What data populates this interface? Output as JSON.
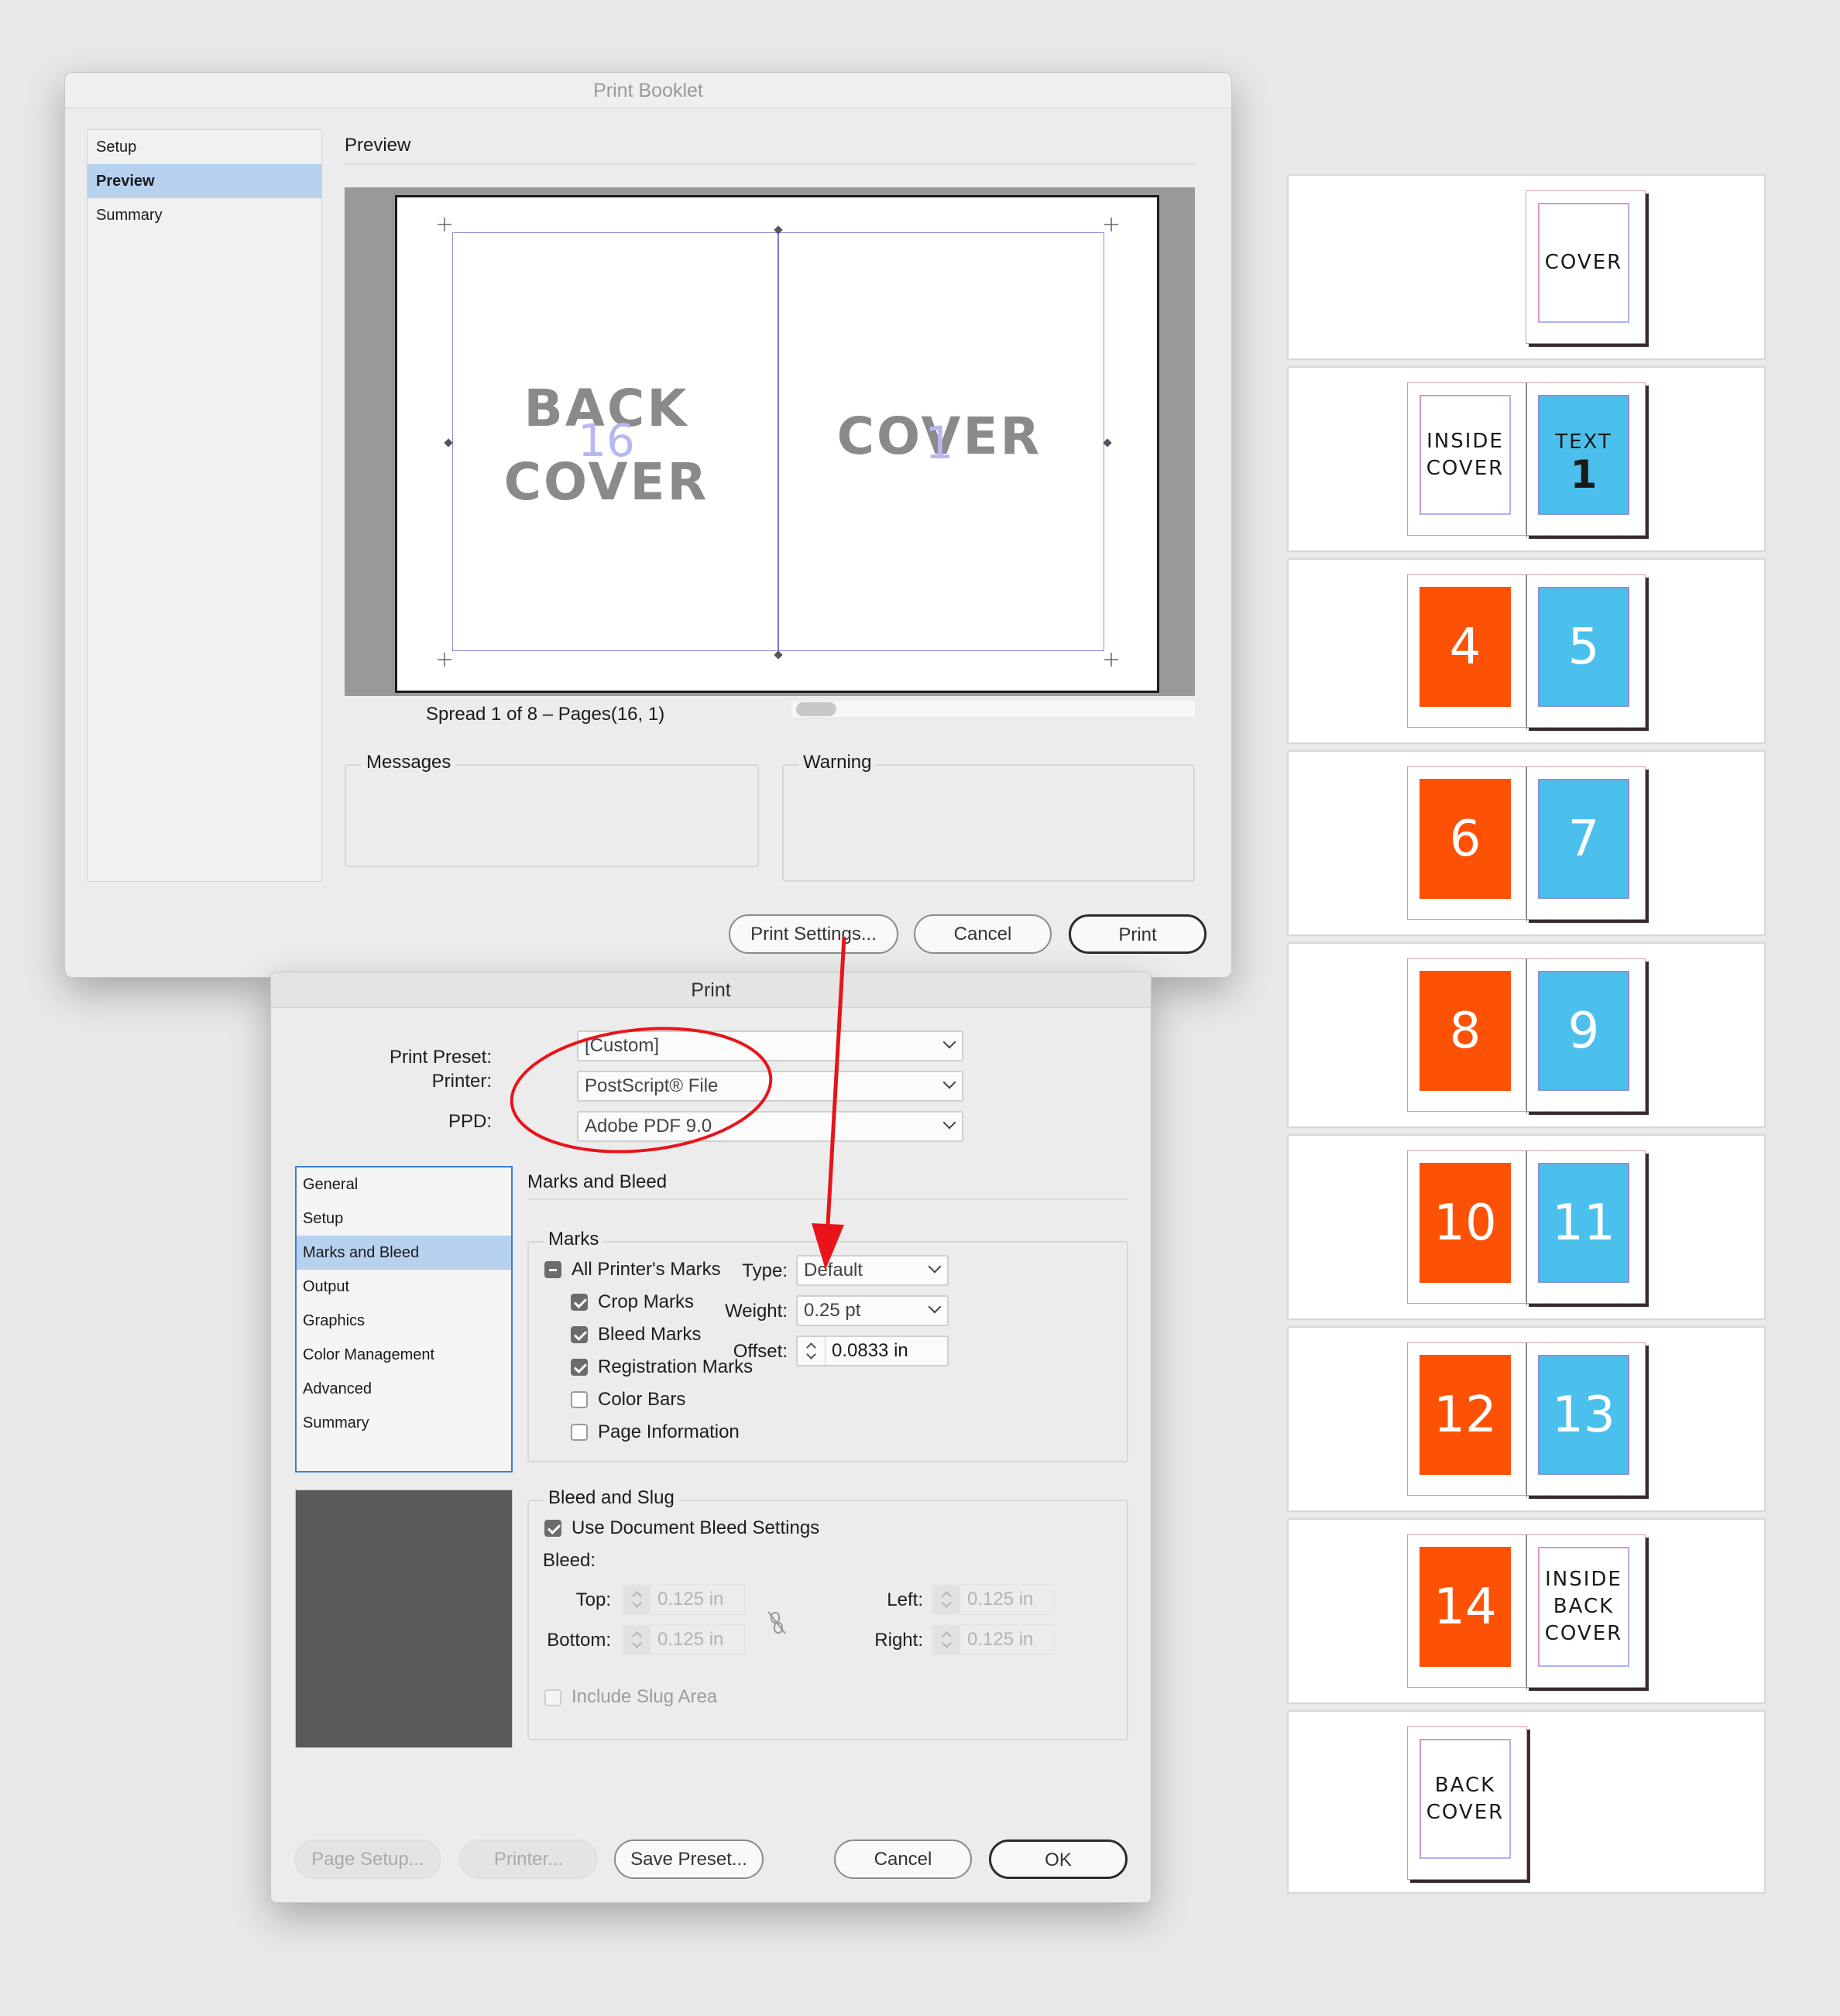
{
  "booklet": {
    "title": "Print Booklet",
    "sidebar": [
      {
        "label": "Setup",
        "selected": false
      },
      {
        "label": "Preview",
        "selected": true
      },
      {
        "label": "Summary",
        "selected": false
      }
    ],
    "section_title": "Preview",
    "spread_left_text": "BACK\nCOVER",
    "spread_left_num": "16",
    "spread_right_text": "COVER",
    "spread_right_num": "1",
    "spread_caption": "Spread 1 of 8 – Pages(16, 1)",
    "messages_label": "Messages",
    "warning_label": "Warning",
    "buttons": {
      "print_settings": "Print Settings...",
      "cancel": "Cancel",
      "print": "Print"
    }
  },
  "print": {
    "title": "Print",
    "preset_label": "Print Preset:",
    "preset_value": "[Custom]",
    "printer_label": "Printer:",
    "printer_value": "PostScript® File",
    "ppd_label": "PPD:",
    "ppd_value": "Adobe PDF 9.0",
    "categories": [
      {
        "label": "General",
        "selected": false
      },
      {
        "label": "Setup",
        "selected": false
      },
      {
        "label": "Marks and Bleed",
        "selected": true
      },
      {
        "label": "Output",
        "selected": false
      },
      {
        "label": "Graphics",
        "selected": false
      },
      {
        "label": "Color Management",
        "selected": false
      },
      {
        "label": "Advanced",
        "selected": false
      },
      {
        "label": "Summary",
        "selected": false
      }
    ],
    "panel_title": "Marks and Bleed",
    "marks": {
      "legend": "Marks",
      "all_printers_marks": "All Printer's Marks",
      "crop_marks": "Crop Marks",
      "bleed_marks": "Bleed Marks",
      "registration_marks": "Registration Marks",
      "color_bars": "Color Bars",
      "page_information": "Page Information",
      "type_label": "Type:",
      "type_value": "Default",
      "weight_label": "Weight:",
      "weight_value": "0.25 pt",
      "offset_label": "Offset:",
      "offset_value": "0.0833 in"
    },
    "bleed": {
      "legend": "Bleed and Slug",
      "use_document": "Use Document Bleed Settings",
      "bleed_label": "Bleed:",
      "top_label": "Top:",
      "top_value": "0.125 in",
      "bottom_label": "Bottom:",
      "bottom_value": "0.125 in",
      "left_label": "Left:",
      "left_value": "0.125 in",
      "right_label": "Right:",
      "right_value": "0.125 in",
      "include_slug": "Include Slug Area"
    },
    "buttons": {
      "page_setup": "Page Setup...",
      "printer": "Printer...",
      "save_preset": "Save Preset...",
      "cancel": "Cancel",
      "ok": "OK"
    }
  },
  "thumbnails": {
    "cover": "COVER",
    "inside_cover": "INSIDE\nCOVER",
    "text_label": "TEXT",
    "text_num": "1",
    "spreads": [
      {
        "left": "4",
        "right": "5"
      },
      {
        "left": "6",
        "right": "7"
      },
      {
        "left": "8",
        "right": "9"
      },
      {
        "left": "10",
        "right": "11"
      },
      {
        "left": "12",
        "right": "13"
      }
    ],
    "p14": "14",
    "inside_back_cover": "INSIDE\nBACK\nCOVER",
    "back_cover": "BACK\nCOVER"
  },
  "colors": {
    "orange": "#fd5106",
    "blue": "#4cc0ec",
    "selection": "#b7d2ef",
    "annotation_red": "#e8141a"
  }
}
